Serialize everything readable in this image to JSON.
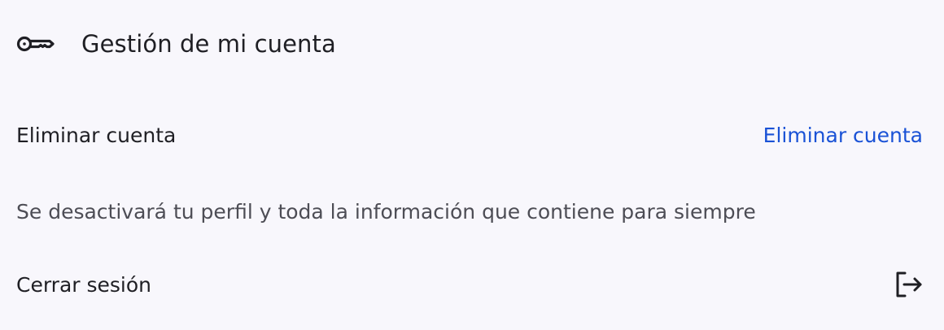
{
  "section": {
    "title": "Gestión de mi cuenta",
    "icon": "key-icon"
  },
  "delete_account": {
    "label": "Eliminar cuenta",
    "action_label": "Eliminar cuenta",
    "description": "Se desactivará tu perfil y toda la información que contiene para siempre"
  },
  "logout": {
    "label": "Cerrar sesión",
    "icon": "logout-icon"
  },
  "colors": {
    "background": "#f8f7fc",
    "text": "#1f1f24",
    "secondary_text": "#4d4d55",
    "link": "#1a52d6"
  }
}
